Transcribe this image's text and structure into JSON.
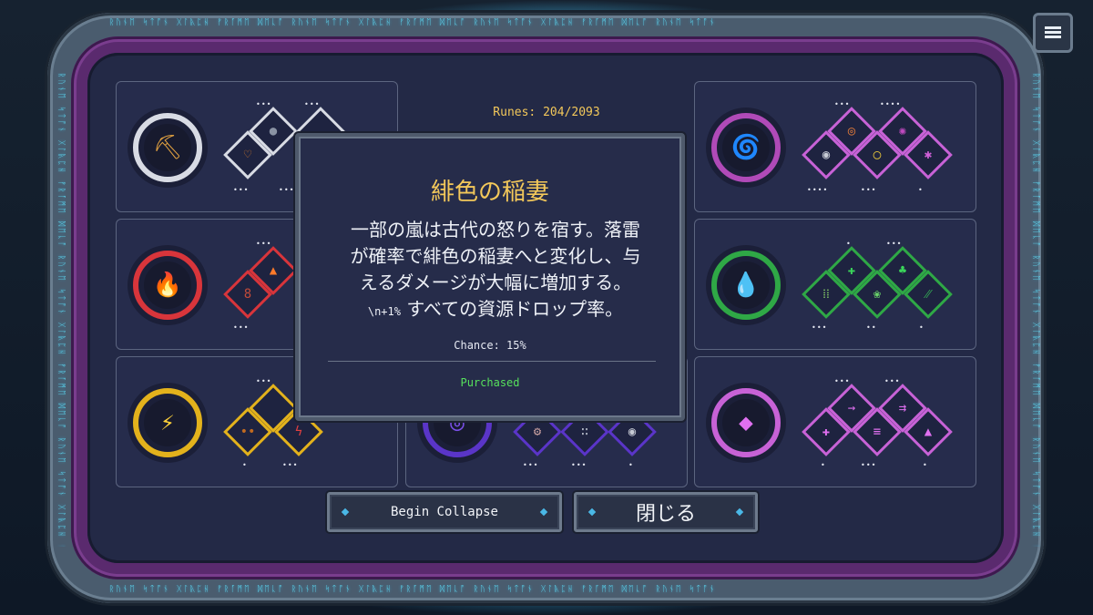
{
  "header": {
    "runes_counter": "Runes: 204/2093"
  },
  "menu_button": {
    "icon": "hamburger-menu-icon"
  },
  "frame": {
    "rune_text": "ᚱᚢᚾᛖ ᛋᛏᚩᚾ ᚷᛚᚣᛈᚺ ᚠᚱᚪᛗᛖ ᛞᛖᚳᚩ ᚱᚢᚾᛖ ᛋᛏᚩᚾ ᚷᛚᚣᛈᚺ ᚠᚱᚪᛗᛖ ᛞᛖᚳᚩ ᚱᚢᚾᛖ ᛋᛏᚩᚾ ᚷᛚᚣᛈᚺ ᚠᚱᚪᛗᛖ ᛞᛖᚳᚩ ᚱᚢᚾᛖ ᛋᛏᚩᚾ"
  },
  "tooltip": {
    "title": "緋色の稲妻",
    "description_lines": [
      "一部の嵐は古代の怒りを宿す。落雷",
      "が確率で緋色の稲妻へと変化し、与",
      "えるダメージが大幅に増加する。"
    ],
    "bonus_prefix": "\\n+1%",
    "bonus_text": " すべての資源ドロップ率。",
    "chance": "Chance: 15%",
    "status": "Purchased"
  },
  "buttons": {
    "begin_collapse": "Begin Collapse",
    "close": "閉じる"
  },
  "colors": {
    "gold": "#f3c85a",
    "purchased_green": "#56e05c",
    "white": "#d8dbe4",
    "red": "#d8353b",
    "yellow": "#e3b21c",
    "violet": "#b04ab8",
    "green": "#2fa846",
    "pink": "#c762d6",
    "indigo": "#5a35c8"
  },
  "skill_trees": [
    {
      "id": "pickaxe",
      "color": "white",
      "icon": "pickaxe-icon",
      "glyph": "⛏",
      "dots": [
        "•••",
        "•••",
        "•••",
        "•••"
      ]
    },
    {
      "id": "fire",
      "color": "red",
      "icon": "flame-icon",
      "glyph": "🔥",
      "dots": [
        "•••",
        "•••"
      ]
    },
    {
      "id": "lightning",
      "color": "yellow",
      "icon": "lightning-bolt-icon",
      "glyph": "⚡",
      "dots": [
        "•••",
        "•",
        "•••"
      ]
    },
    {
      "id": "void",
      "color": "violet",
      "icon": "vortex-icon",
      "glyph": "🌀",
      "dots": [
        "•••",
        "••••",
        "••••",
        "•••",
        "•"
      ]
    },
    {
      "id": "nature",
      "color": "green",
      "icon": "droplet-icon",
      "glyph": "💧",
      "dots": [
        "•",
        "•••",
        "•••",
        "••",
        "•"
      ]
    },
    {
      "id": "arcane",
      "color": "pink",
      "icon": "crystal-shard-icon",
      "glyph": "◆",
      "dots": [
        "•••",
        "•••",
        "•",
        "•••",
        "•"
      ]
    },
    {
      "id": "cosmic",
      "color": "indigo",
      "icon": "spiral-icon",
      "glyph": "◎",
      "dots": [
        "•••",
        "•••",
        "•"
      ]
    }
  ]
}
